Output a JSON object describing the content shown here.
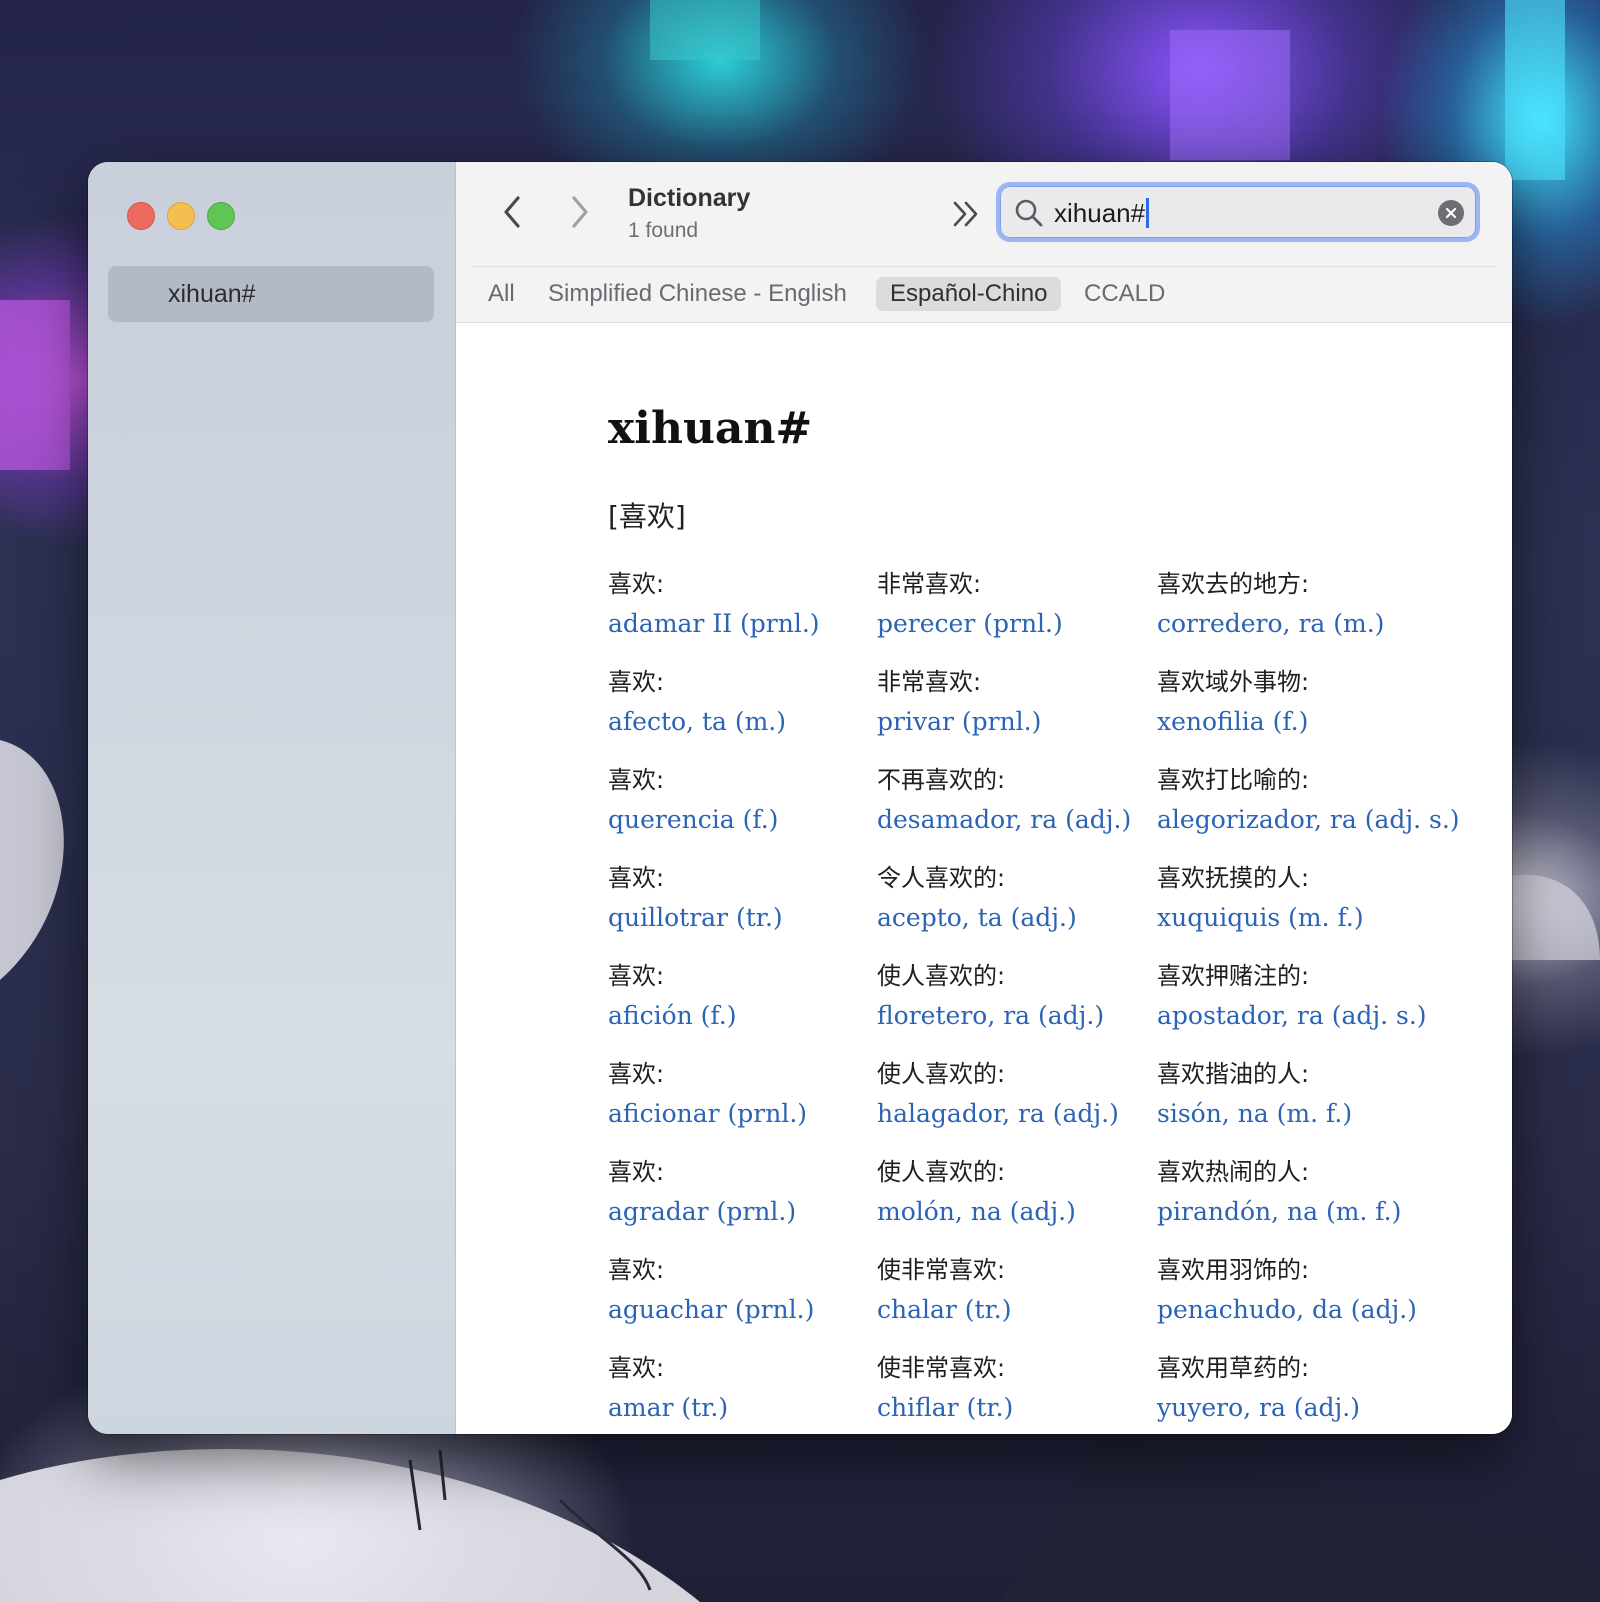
{
  "app": {
    "title": "Dictionary",
    "subtitle": "1 found"
  },
  "sidebar": {
    "items": [
      {
        "label": "xihuan#"
      }
    ]
  },
  "search": {
    "value": "xihuan#"
  },
  "tabs": [
    {
      "label": "All",
      "active": false
    },
    {
      "label": "Simplified Chinese - English",
      "active": false
    },
    {
      "label": "Español-Chino",
      "active": true
    },
    {
      "label": "CCALD",
      "active": false
    }
  ],
  "entry": {
    "headword": "xihuan#",
    "hanzi": "[喜欢]",
    "columns": [
      [
        {
          "zh": "喜欢:",
          "es": "adamar II (prnl.)"
        },
        {
          "zh": "喜欢:",
          "es": "afecto, ta (m.)"
        },
        {
          "zh": "喜欢:",
          "es": "querencia (f.)"
        },
        {
          "zh": "喜欢:",
          "es": "quillotrar (tr.)"
        },
        {
          "zh": "喜欢:",
          "es": "afición (f.)"
        },
        {
          "zh": "喜欢:",
          "es": "aficionar (prnl.)"
        },
        {
          "zh": "喜欢:",
          "es": "agradar (prnl.)"
        },
        {
          "zh": "喜欢:",
          "es": "aguachar (prnl.)"
        },
        {
          "zh": "喜欢:",
          "es": "amar (tr.)"
        }
      ],
      [
        {
          "zh": "非常喜欢:",
          "es": "perecer (prnl.)"
        },
        {
          "zh": "非常喜欢:",
          "es": "privar (prnl.)"
        },
        {
          "zh": "不再喜欢的:",
          "es": "desamador, ra (adj.)"
        },
        {
          "zh": "令人喜欢的:",
          "es": "acepto, ta (adj.)"
        },
        {
          "zh": "使人喜欢的:",
          "es": "floretero, ra (adj.)"
        },
        {
          "zh": "使人喜欢的:",
          "es": "halagador, ra (adj.)"
        },
        {
          "zh": "使人喜欢的:",
          "es": "molón, na (adj.)"
        },
        {
          "zh": "使非常喜欢:",
          "es": "chalar (tr.)"
        },
        {
          "zh": "使非常喜欢:",
          "es": "chiflar (tr.)"
        }
      ],
      [
        {
          "zh": "喜欢去的地方:",
          "es": "corredero, ra (m.)"
        },
        {
          "zh": "喜欢域外事物:",
          "es": "xenofilia (f.)"
        },
        {
          "zh": "喜欢打比喻的:",
          "es": "alegorizador, ra (adj. s.)"
        },
        {
          "zh": "喜欢抚摸的人:",
          "es": "xuquiquis (m. f.)"
        },
        {
          "zh": "喜欢押赌注的:",
          "es": "apostador, ra (adj. s.)"
        },
        {
          "zh": "喜欢揩油的人:",
          "es": "sisón, na (m. f.)"
        },
        {
          "zh": "喜欢热闹的人:",
          "es": "pirandón, na (m. f.)"
        },
        {
          "zh": "喜欢用羽饰的:",
          "es": "penachudo, da (adj.)"
        },
        {
          "zh": "喜欢用草药的:",
          "es": "yuyero, ra (adj.)"
        }
      ]
    ]
  },
  "colors": {
    "link": "#2b63b5",
    "search_focus": "#9ab6f3",
    "traffic_close": "#ed6a5e",
    "traffic_minimize": "#f5bf4f",
    "traffic_zoom": "#61c554"
  },
  "icons": [
    "back-chevron-icon",
    "forward-chevron-icon",
    "expand-chevrons-icon",
    "search-icon",
    "clear-icon"
  ]
}
